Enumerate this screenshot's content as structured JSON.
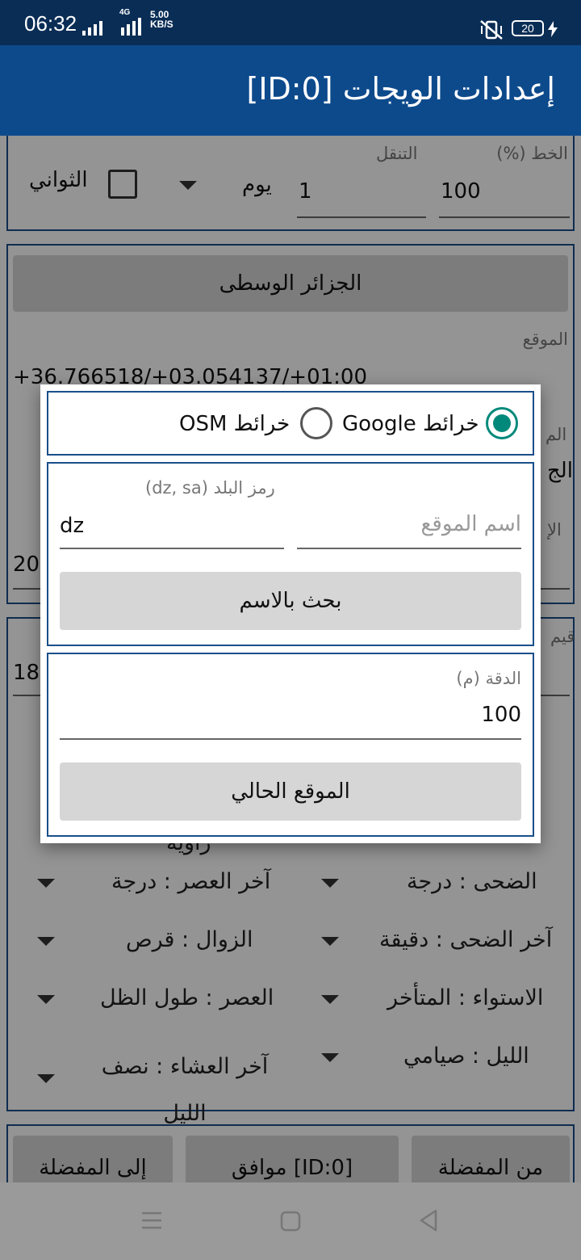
{
  "status_bar": {
    "time": "06:32",
    "net_type": "4G",
    "net_speed_value": "5.00",
    "net_speed_unit": "KB/S",
    "battery": "20",
    "icons": [
      "signal-icon",
      "mute-vibrate-icon",
      "battery-icon",
      "charging-icon"
    ]
  },
  "app_bar": {
    "title": "إعدادات الويجات [ID:0]"
  },
  "top_panel": {
    "font_label": "الخط (%)",
    "font_value": "100",
    "nav_label": "التنقل",
    "nav_value": "1",
    "unit_value": "يوم",
    "seconds_label": "الثواني"
  },
  "location_panel": {
    "city_button": "الجزائر الوسطى",
    "location_label": "الموقع",
    "coords": "+36.766518/+03.054137/+01:00",
    "partial_left_1": "20",
    "partial_right_1": "الم",
    "partial_right_2": "الج",
    "partial_right_3": "الإ",
    "partial_right_4": "قيم"
  },
  "settings_panel": {
    "value_partial": "18",
    "partial_top": "زاوية",
    "rows": [
      {
        "right": "الضحى : درجة",
        "left": "آخر العصر : درجة"
      },
      {
        "right": "آخر الضحى : دقيقة",
        "left": "الزوال : قرص"
      },
      {
        "right": "الاستواء : المتأخر",
        "left": "العصر : طول الظل"
      },
      {
        "right": "الليل : صيامي",
        "left": "آخر العشاء : نصف الليل"
      }
    ]
  },
  "bottom_buttons": {
    "from_favorites": "من المفضلة",
    "ok": "موافق [ID:0]",
    "to_favorites": "إلى المفضلة"
  },
  "dialog": {
    "radio_google": "خرائط Google",
    "radio_osm": "خرائط OSM",
    "selected": "google",
    "country_code_label": "رمز البلد (dz, sa)",
    "country_code_value": "dz",
    "location_name_placeholder": "اسم الموقع",
    "search_button": "بحث بالاسم",
    "accuracy_label": "الدقة (م)",
    "accuracy_value": "100",
    "current_location_button": "الموقع الحالي"
  },
  "nav_bar": {
    "icons": [
      "menu-icon",
      "home-icon",
      "back-icon"
    ]
  }
}
